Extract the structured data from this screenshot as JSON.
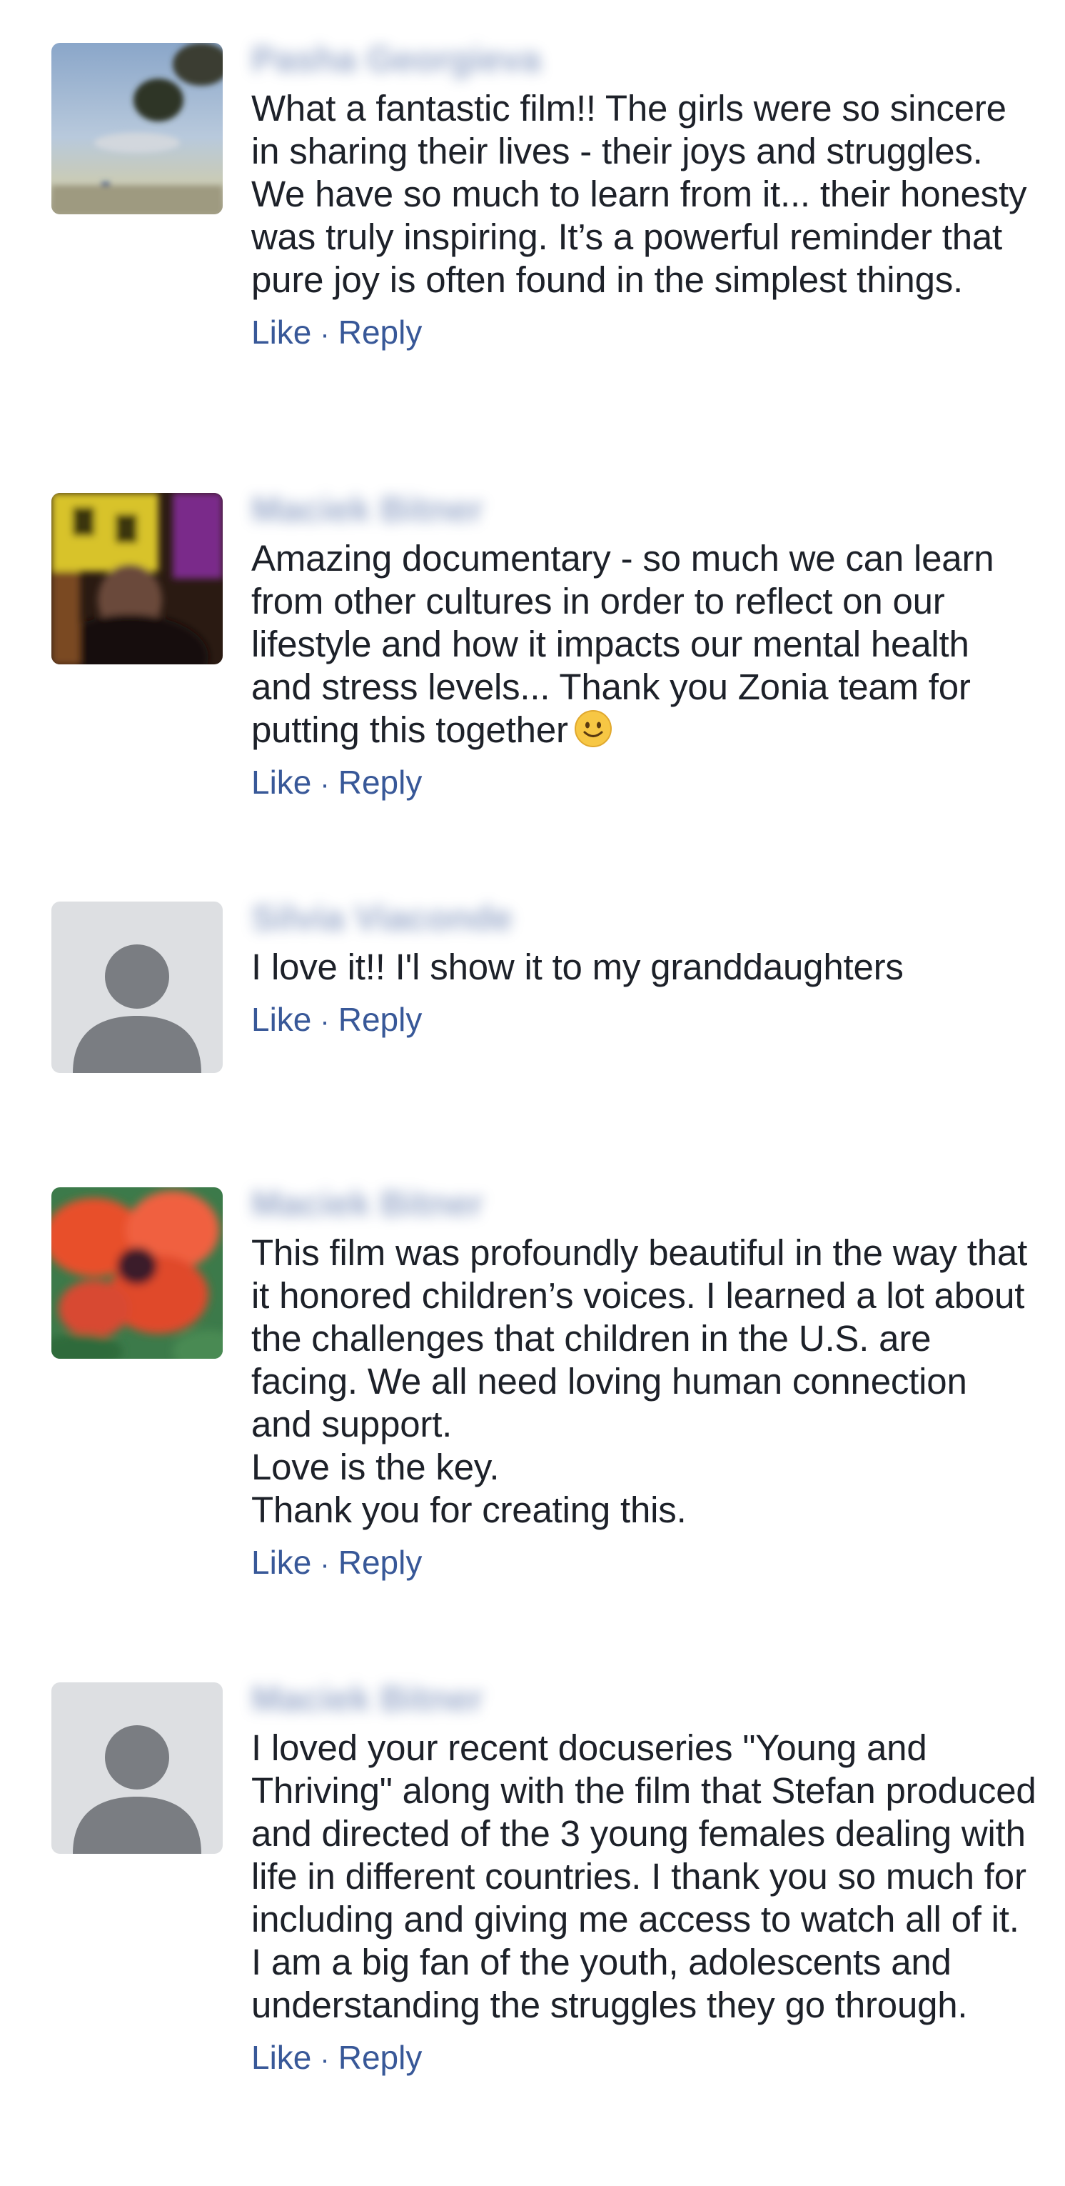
{
  "comments": [
    {
      "author": "Pasha Georgieva",
      "text": "What a fantastic film!! The girls were so sincere in sharing their lives - their joys and struggles. We have so much to learn from it... their honesty was truly inspiring. It’s a powerful reminder that pure joy is often found in the simplest things.",
      "avatar": "beach-photo",
      "like_label": "Like",
      "reply_label": "Reply",
      "separator": "·"
    },
    {
      "author": "Maciek Bitner",
      "text": "Amazing documentary - so much we can learn from other cultures in order to reflect on our lifestyle and how it impacts our mental health and stress levels... Thank you Zonia team for putting this together",
      "emoji": "smiley-face-icon",
      "avatar": "person-photo",
      "like_label": "Like",
      "reply_label": "Reply",
      "separator": "·"
    },
    {
      "author": "Silvia Viaconde",
      "text": "I love it!! I'l show it to my granddaughters",
      "avatar": "default-silhouette",
      "like_label": "Like",
      "reply_label": "Reply",
      "separator": "·"
    },
    {
      "author": "Maciek Bitner",
      "text": "This film was profoundly beautiful in the way that it honored children’s voices. I learned a lot about the challenges that children in the U.S. are facing. We all need loving human connection and support.\nLove is the key.\nThank you for creating this.",
      "avatar": "flower-photo",
      "like_label": "Like",
      "reply_label": "Reply",
      "separator": "·"
    },
    {
      "author": "Maciek Bitner",
      "text": "I loved your recent docuseries \"Young and Thriving\" along with the film that Stefan produced and directed of the 3 young females dealing with life in different countries. I thank you so much for including and giving me access to watch all of it. I am a big fan of the youth, adolescents and understanding the struggles they go through.",
      "avatar": "default-silhouette",
      "like_label": "Like",
      "reply_label": "Reply",
      "separator": "·"
    }
  ],
  "colors": {
    "link": "#385898",
    "text": "#1d2129",
    "avatar_placeholder": "#dddfe2",
    "silhouette": "#7a7d82"
  }
}
